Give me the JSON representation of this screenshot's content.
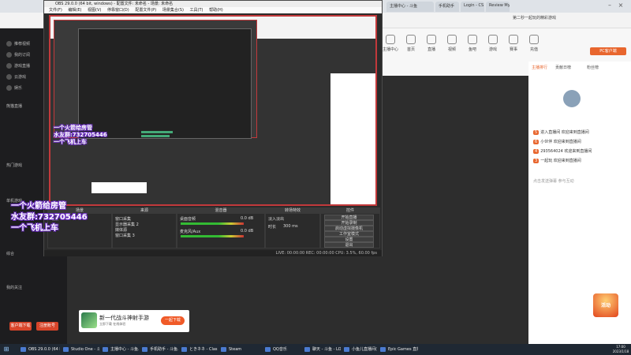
{
  "browser": {
    "tabs": [
      "主播中心 - 斗鱼",
      "手机助手",
      "Login - CS",
      "Review My",
      "第二秒一起玩的精彩游戏"
    ],
    "right_links": [
      "第二秒一起玩的精彩游戏",
      "其他收藏",
      "×"
    ]
  },
  "douyu_sidebar": {
    "items": [
      "推荐视频",
      "我的订阅",
      "游戏直播",
      "云游戏",
      "娱乐",
      "熊猫直播",
      "热门游戏",
      "单机游戏",
      "综合",
      "我的关注",
      "热门分类"
    ],
    "buttons": [
      "客户端下载",
      "注册账号"
    ]
  },
  "douyu_categories": [
    "主播中心",
    "首页",
    "直播",
    "视频",
    "鱼吧",
    "游戏",
    "赛事",
    "充值"
  ],
  "douyu_topbar": {
    "button": "PC客户端",
    "user_badge": "主播等级"
  },
  "chat": {
    "tabs": [
      "主播排行",
      "贡献日榜",
      "周榜",
      "粉丝榜"
    ],
    "lines": [
      {
        "badge": "5",
        "text": "进入直播间 欢迎来到直播间"
      },
      {
        "badge": "6",
        "text": "小伙伴 欢迎来到直播间"
      },
      {
        "badge": "4",
        "text": "293564024 欢迎来到直播间"
      },
      {
        "badge": "3",
        "text": "一起玩 欢迎来到直播间"
      }
    ],
    "footer": "点击发送弹幕 参与互动"
  },
  "obs": {
    "title": "OBS 29.0.0 (64 bit, windows) - 配置文件: 未命名 - 场景: 未命名",
    "menu": [
      "文件(F)",
      "编辑(E)",
      "视图(V)",
      "停靠窗口(D)",
      "配置文件(P)",
      "场景集合(S)",
      "工具(T)",
      "帮助(H)"
    ],
    "docks": {
      "scenes": {
        "title": "场景",
        "items": [
          "场景"
        ]
      },
      "sources": {
        "title": "来源",
        "items": [
          "窗口采集",
          "显示器采集 2",
          "媒体源",
          "窗口采集 3"
        ]
      },
      "mixer": {
        "title": "混音器",
        "tracks": [
          "桌面音频",
          "麦克风/Aux"
        ],
        "levels": [
          "0.0 dB",
          "0.0 dB"
        ]
      },
      "transitions": {
        "title": "转场特效",
        "type": "淡入淡出",
        "duration_label": "时长",
        "duration": "300 ms"
      },
      "controls": {
        "title": "控件",
        "buttons": [
          "开始直播",
          "开始录制",
          "启动虚拟摄像机",
          "工作室模式",
          "设置",
          "退出"
        ]
      }
    },
    "status": "LIVE: 00:00:00   REC: 00:00:00   CPU: 3.5%, 60.00 fps"
  },
  "overlay": {
    "line1": "一个火箭给房管",
    "line2": "水友群:732705446",
    "line3": "一个飞机上车"
  },
  "ad": {
    "title": "新一代战斗神射手游",
    "subtitle": "立即下载  在线体验",
    "button": "一起下载"
  },
  "gift": {
    "label": "活动"
  },
  "taskbar": {
    "items": [
      "OBS 29.0.0 (64 bit...",
      "Studio One - 斗鱼...",
      "主播中心 - 斗鱼...",
      "手机助手 - 斗鱼...",
      "ときネネ - Clas...",
      "Steam",
      "QQ音乐",
      "聊天 - 斗鱼 - LOVE...",
      "小鱼儿直播间(飞)",
      "Epic Games 直播"
    ],
    "time": "17:00",
    "date": "2023/1/18"
  }
}
